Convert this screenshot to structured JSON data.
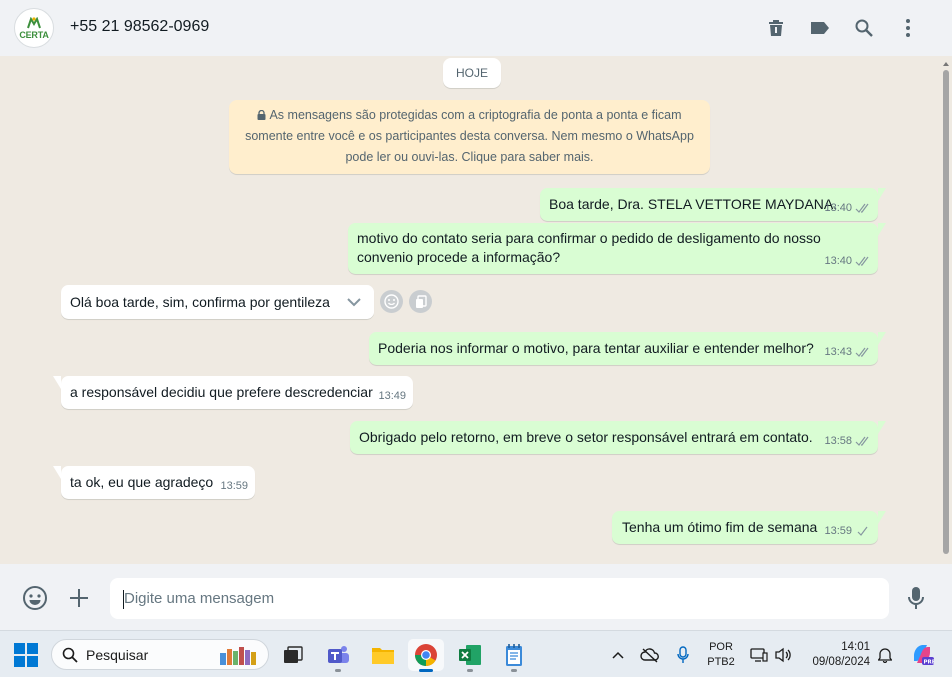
{
  "header": {
    "avatar_text": "CERTA",
    "contact": "+55 21 98562-0969",
    "icons": [
      "trash-icon",
      "label-icon",
      "search-icon",
      "more-vertical-icon"
    ]
  },
  "chat": {
    "date_chip": "HOJE",
    "encryption_notice": "As mensagens são protegidas com a criptografia de ponta a ponta e ficam somente entre você e os participantes desta conversa. Nem mesmo o WhatsApp pode ler ou ouvi-las. Clique para saber mais.",
    "messages": [
      {
        "dir": "out",
        "text": "Boa tarde, Dra. STELA VETTORE MAYDANA.",
        "time": "13:40"
      },
      {
        "dir": "out",
        "text": "motivo do contato seria para confirmar o pedido de desligamento do nosso convenio procede a informação?",
        "time": "13:40"
      },
      {
        "dir": "in",
        "text": "Olá boa tarde, sim, confirma por gentileza",
        "time": ""
      },
      {
        "dir": "out",
        "text": "Poderia nos informar o motivo, para tentar auxiliar e entender melhor?",
        "time": "13:43"
      },
      {
        "dir": "in",
        "text": "a responsável decidiu que prefere descredenciar",
        "time": "13:49"
      },
      {
        "dir": "out",
        "text": "Obrigado pelo retorno, em breve o setor responsável entrará em contato.",
        "time": "13:58"
      },
      {
        "dir": "in",
        "text": "ta ok, eu que agradeço",
        "time": "13:59"
      },
      {
        "dir": "out",
        "text": "Tenha um ótimo fim de semana",
        "time": "13:59"
      }
    ]
  },
  "composer": {
    "placeholder": "Digite uma mensagem"
  },
  "taskbar": {
    "search_label": "Pesquisar",
    "lang_line1": "POR",
    "lang_line2": "PTB2",
    "time": "14:01",
    "date": "09/08/2024"
  },
  "colors": {
    "outgoing_bubble": "#d9fdd3",
    "incoming_bubble": "#ffffff",
    "chat_bg": "#efeae2",
    "tick_blue": "#53bdeb",
    "brand_green": "#3c8f3c"
  }
}
